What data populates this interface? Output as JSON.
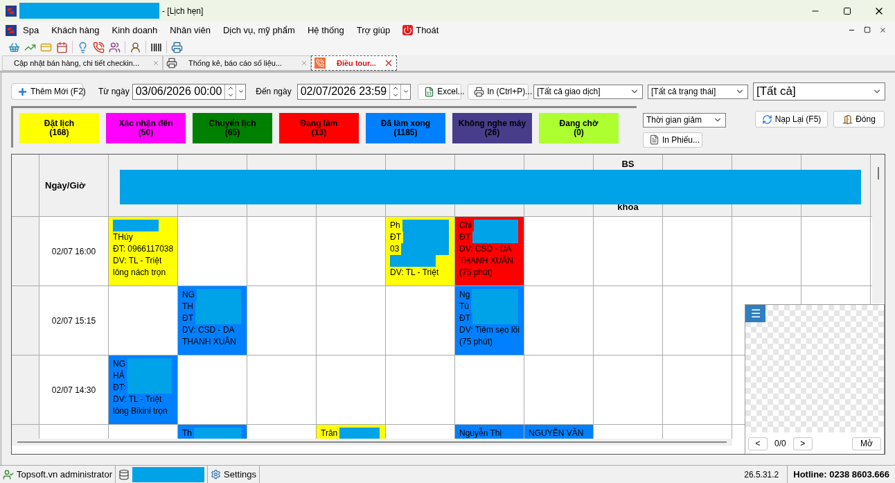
{
  "window": {
    "title": "- [Lịch hẹn]"
  },
  "menu": [
    "Spa",
    "Khách hàng",
    "Kinh doanh",
    "Nhân viên",
    "Dịch vụ, mỹ phẩm",
    "Hệ thống",
    "Trợ giúp",
    "Thoát"
  ],
  "tabs": [
    {
      "label": "Cập nhật bán hàng, chi tiết checkin...",
      "selected": false
    },
    {
      "label": "Thống kê, báo cáo số liệu...",
      "selected": false
    },
    {
      "label": "Điều tour...",
      "selected": true
    }
  ],
  "filters": {
    "add_button": "Thêm Mới (F2)",
    "from_label": "Từ ngày",
    "from_value": "03/06/2026 00:00",
    "to_label": "Đến ngày",
    "to_value": "02/07/2026 23:59",
    "excel_button": "Excel...",
    "print_button": "In (Ctrl+P)...",
    "transaction_select": "[Tất cả giao dịch]",
    "status_select": "[Tất cả trạng thái]",
    "all_select": "[Tất cả]"
  },
  "legend": [
    {
      "label": "Đặt lịch",
      "count": "(168)",
      "color": "#ffff00"
    },
    {
      "label": "Xác nhận đến",
      "count": "(50)",
      "color": "#ff00ff"
    },
    {
      "label": "Chuyển lịch",
      "count": "(65)",
      "color": "#008000"
    },
    {
      "label": "Đang làm",
      "count": "(13)",
      "color": "#ff0000"
    },
    {
      "label": "Đã làm xong",
      "count": "(1185)",
      "color": "#0080ff"
    },
    {
      "label": "Không nghe máy",
      "count": "(26)",
      "color": "#483d8b"
    },
    {
      "label": "Đang chờ",
      "count": "(0)",
      "color": "#adff2f"
    }
  ],
  "actions": {
    "sort_select": "Thời gian giảm",
    "print_slip": "In Phiếu...",
    "reload": "Nạp Lại (F5)",
    "close": "Đóng"
  },
  "table": {
    "time_header": "Ngày/Giờ",
    "staff_header_text": {
      "top": "BS",
      "bottom": "khoa"
    },
    "rows": [
      {
        "time": "02/07 16:00",
        "cells": [
          {
            "color": "#ffff00",
            "lines": [
              {
                "redacted": true
              },
              {
                "text": "THúy",
                "redacted": false
              },
              {
                "text": "ĐT: 0966117038",
                "redacted": false
              },
              {
                "text": "DV: TL - Triệt",
                "redacted": false
              },
              {
                "text": "lông nách trọn",
                "redacted": false
              }
            ]
          },
          "",
          "",
          "",
          {
            "color": "#ffff00",
            "lines": [
              {
                "text": "Ph",
                "redacted": true
              },
              {
                "text": "ĐT",
                "redacted": true
              },
              {
                "text": "03",
                "redacted": true
              },
              {
                "redacted": true
              },
              {
                "text": "DV: TL - Triệt",
                "redacted": false
              }
            ]
          },
          {
            "color": "#ff0000",
            "lines": [
              {
                "text": "Chi",
                "redacted": true
              },
              {
                "text": "ĐT",
                "redacted": true
              },
              {
                "text": "DV: CSD - DA",
                "redacted": false
              },
              {
                "text": "THANH XUÂN",
                "redacted": false
              },
              {
                "text": "(75 phút)",
                "redacted": false
              }
            ]
          },
          "",
          "",
          "",
          "",
          ""
        ]
      },
      {
        "time": "02/07 15:15",
        "cells": [
          "",
          {
            "color": "#0080ff",
            "lines": [
              {
                "text": "NG",
                "redacted": true
              },
              {
                "text": "TH",
                "redacted": true
              },
              {
                "text": "ĐT",
                "redacted": true
              },
              {
                "text": "DV: CSD - DA",
                "redacted": false
              },
              {
                "text": "THANH XUÂN",
                "redacted": false
              }
            ]
          },
          "",
          "",
          "",
          {
            "color": "#0080ff",
            "lines": [
              {
                "text": "Ng",
                "redacted": true
              },
              {
                "text": "Tù",
                "redacted": true
              },
              {
                "text": "ĐT",
                "redacted": true
              },
              {
                "text": "DV: Tiêm sẹo lồi",
                "redacted": false
              },
              {
                "text": "(75 phút)",
                "redacted": false
              }
            ]
          },
          "",
          "",
          "",
          "",
          ""
        ]
      },
      {
        "time": "02/07 14:30",
        "cells": [
          {
            "color": "#0080ff",
            "lines": [
              {
                "text": "NG",
                "redacted": true
              },
              {
                "text": "HẢ",
                "redacted": true
              },
              {
                "text": "ĐT:",
                "redacted": true
              },
              {
                "text": "DV: TL - Triệt",
                "redacted": false
              },
              {
                "text": "lông Bikini trọn",
                "redacted": false
              }
            ]
          },
          "",
          "",
          "",
          "",
          "",
          "",
          "",
          "",
          "",
          ""
        ]
      },
      {
        "cells": [
          "",
          {
            "color": "#0080ff",
            "lines": [
              {
                "text": "Th",
                "redacted": true
              }
            ]
          },
          "",
          {
            "color": "#ffff00",
            "lines": [
              {
                "text": "Trân",
                "redacted": true
              }
            ]
          },
          "",
          {
            "color": "#0080ff",
            "lines": [
              {
                "text": "Nguyễn Thị",
                "redacted": false
              }
            ]
          },
          {
            "color": "#0080ff",
            "lines": [
              {
                "text": "NGUYỄN VĂN",
                "redacted": false
              }
            ]
          },
          "",
          "",
          "",
          ""
        ]
      }
    ]
  },
  "preview": {
    "menu_glyph": "☰",
    "prev": "<",
    "counter": "0/0",
    "next": ">",
    "open": "Mở"
  },
  "status_bar": {
    "user": "Topsoft.vn administrator",
    "settings": "Settings",
    "version": "26.5.31.2",
    "hotline": "Hotline: 0238 8603.666"
  }
}
